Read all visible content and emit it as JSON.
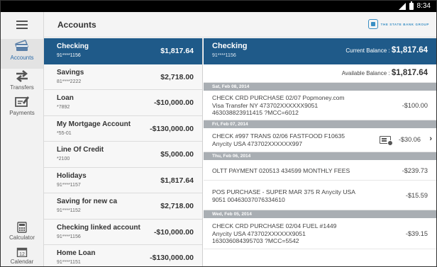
{
  "status_bar": {
    "time": "8:34"
  },
  "header": {
    "title": "Accounts",
    "logo_text": "THE STATE BANK GROUP"
  },
  "rail": {
    "items": [
      {
        "label": "Accounts",
        "icon": "accounts-icon",
        "active": true
      },
      {
        "label": "Transfers",
        "icon": "transfers-icon"
      },
      {
        "label": "Payments",
        "icon": "payments-icon"
      },
      {
        "label": "Calculator",
        "icon": "calculator-icon"
      },
      {
        "label": "Calendar",
        "icon": "calendar-icon",
        "day": "12"
      }
    ]
  },
  "accounts": [
    {
      "name": "Checking",
      "number": "91****1156",
      "balance": "$1,817.64",
      "selected": true
    },
    {
      "name": "Savings",
      "number": "81****2222",
      "balance": "$2,718.00"
    },
    {
      "name": "Loan",
      "number": "*7892",
      "balance": "-$10,000.00"
    },
    {
      "name": "My Mortgage Account",
      "number": "*55-01",
      "balance": "-$130,000.00"
    },
    {
      "name": "Line Of Credit",
      "number": "*2100",
      "balance": "$5,000.00"
    },
    {
      "name": "Holidays",
      "number": "91****1157",
      "balance": "$1,817.64"
    },
    {
      "name": "Saving for new ca",
      "number": "91****1152",
      "balance": "$2,718.00"
    },
    {
      "name": "Checking linked account",
      "number": "91****1156",
      "balance": "-$10,000.00"
    },
    {
      "name": "Home Loan",
      "number": "91****1151",
      "balance": "-$130,000.00"
    }
  ],
  "details": {
    "name": "Checking",
    "number": "91****1156",
    "current_label": "Current Balance : ",
    "current_value": "$1,817.64",
    "available_label": "Available Balance : ",
    "available_value": "$1,817.64",
    "groups": [
      {
        "date": "Sat, Feb 08, 2014",
        "transactions": [
          {
            "lines": [
              "CHECK CRD PURCHASE 02/07 Popmoney.com",
              "Visa Transfer NY 473702XXXXXX9051",
              "463038823911415 ?MCC=6012"
            ],
            "amount": "-$100.00"
          }
        ]
      },
      {
        "date": "Fri, Feb 07, 2014",
        "transactions": [
          {
            "lines": [
              "CHECK #997 TRANS 02/06 FASTFOOD F10635",
              "Anycity USA 473702XXXXXX997"
            ],
            "amount": "-$30.06",
            "has_image": true
          }
        ]
      },
      {
        "date": "Thu, Feb 06, 2014",
        "transactions": [
          {
            "lines": [
              "OLTT PAYMENT 020513 434599 MONTHLY FEES"
            ],
            "amount": "-$239.73"
          },
          {
            "lines": [
              "POS PURCHASE - SUPER MAR 375 R Anycity USA",
              "9051 00463037076334610"
            ],
            "amount": "-$15.59"
          }
        ]
      },
      {
        "date": "Wed, Feb 05, 2014",
        "transactions": [
          {
            "lines": [
              "CHECK CRD PURCHASE 02/04 FUEL #1449",
              "Anycity USA 473702XXXXXX9051",
              "163036084395703 ?MCC=5542"
            ],
            "amount": "-$39.15"
          }
        ]
      }
    ]
  },
  "colors": {
    "accent": "#1f5a89",
    "date_bar": "#a9aeb3",
    "logo": "#3a8fc4"
  }
}
